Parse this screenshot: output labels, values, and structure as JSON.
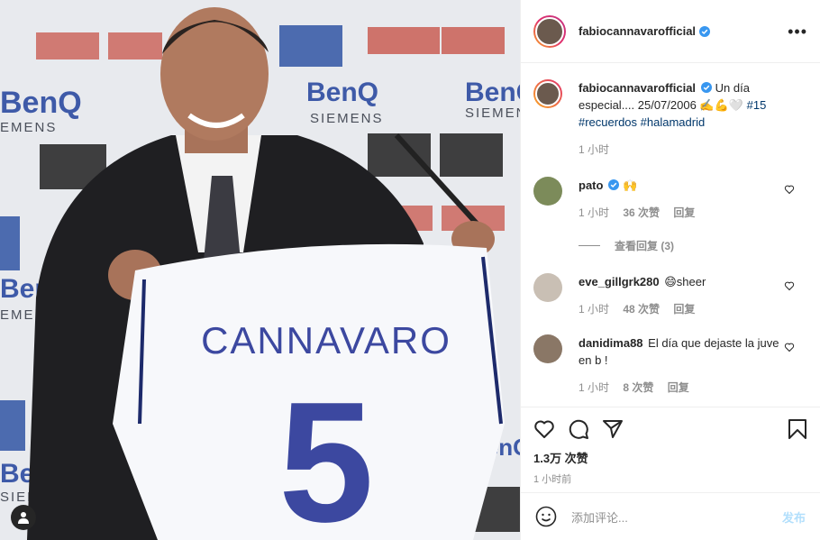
{
  "post": {
    "username": "fabiocannavarofficial",
    "more_icon": "more-horizontal-icon",
    "jersey_name": "CANNAVARO",
    "jersey_number": "5",
    "sponsor_brand": "BenQ SIEMENS"
  },
  "caption": {
    "username": "fabiocannavarofficial",
    "text": "Un día especial.... 25/07/2006 ✍️💪🤍",
    "hashtags": "#15 #recuerdos #halamadrid",
    "time": "1 小时"
  },
  "comments": [
    {
      "username": "pato",
      "verified": true,
      "text": "🙌",
      "time": "1 小时",
      "likes": "36 次赞",
      "reply": "回复",
      "view_replies": "查看回复 (3)"
    },
    {
      "username": "eve_gillgrk280",
      "verified": false,
      "text": "😄sheer",
      "time": "1 小时",
      "likes": "48 次赞",
      "reply": "回复"
    },
    {
      "username": "danidima88",
      "verified": false,
      "text": "El día que dejaste la juve en b !",
      "time": "1 小时",
      "likes": "8 次赞",
      "reply": "回复"
    }
  ],
  "actions": {
    "like_count": "1.3万 次赞",
    "posted_ago": "1 小时前"
  },
  "add_comment": {
    "placeholder": "添加评论...",
    "post_label": "发布"
  },
  "colors": {
    "verified_blue": "#3897f0",
    "hashtag_blue": "#00376b",
    "muted": "#8e8e8e",
    "post_disabled": "#b2dffc"
  }
}
